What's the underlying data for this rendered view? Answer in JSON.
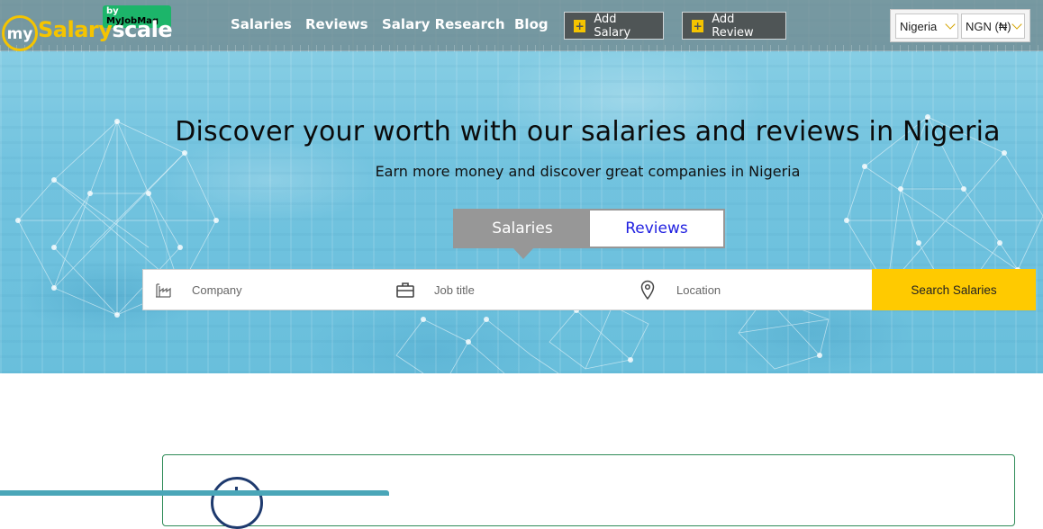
{
  "brand": {
    "logo_my": "my",
    "logo_salary": "Salary",
    "logo_scale": "scale",
    "badge_by": "by",
    "badge_name": "MyJobMag",
    "accent_color": "#f5c400",
    "badge_color": "#1cb56a"
  },
  "nav": {
    "links": [
      "Salaries",
      "Reviews",
      "Salary Research",
      "Blog"
    ],
    "add_salary": "Add Salary",
    "add_review": "Add Review",
    "plus_icon": "+",
    "country": "Nigeria",
    "currency": "NGN (₦)"
  },
  "hero": {
    "title": "Discover your worth with our salaries and reviews in Nigeria",
    "subtitle": "Earn more money and discover great companies in Nigeria"
  },
  "tabs": {
    "active": "Salaries",
    "inactive": "Reviews"
  },
  "search": {
    "company_placeholder": "Company",
    "job_placeholder": "Job title",
    "location_placeholder": "Location",
    "button": "Search Salaries",
    "button_color": "#ffca00",
    "icons": [
      "factory-icon",
      "briefcase-icon",
      "location-pin-icon"
    ]
  }
}
